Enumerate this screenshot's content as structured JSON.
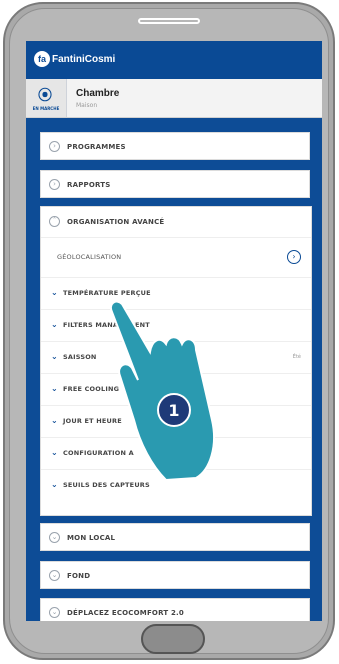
{
  "app": {
    "logo_text": "FantiniCosmi",
    "logo_initial": "fa"
  },
  "header": {
    "title": "Chambre",
    "subtitle": "Maison",
    "button_label": "EN MARCHE",
    "button_icon": "remote-icon"
  },
  "menu": [
    {
      "label": "PROGRAMMES"
    },
    {
      "label": "RAPPORTS"
    }
  ],
  "expanded": {
    "label": "ORGANISATION AVANCÉ",
    "geo_label": "GÉOLOCALISATION",
    "items": [
      {
        "label": "TEMPÉRATURE PERÇUE",
        "value": ""
      },
      {
        "label": "FILTERS MANAGEMENT",
        "value": ""
      },
      {
        "label": "SAISSON",
        "value": "Été"
      },
      {
        "label": "FREE COOLING",
        "value": ""
      },
      {
        "label": "JOUR ET HEURE",
        "value": ""
      },
      {
        "label": "CONFIGURATION A",
        "value": ""
      },
      {
        "label": "SEUILS DES CAPTEURS",
        "value": ""
      }
    ]
  },
  "menu_bottom": [
    {
      "label": "MON LOCAL"
    },
    {
      "label": "FOND"
    },
    {
      "label": "DÉPLACEZ ECOCOMFORT 2.0"
    }
  ],
  "annotation": {
    "step": "1"
  },
  "colors": {
    "brand": "#0a4a95",
    "hand": "#2a9ab0",
    "badge": "#1e3a78"
  }
}
